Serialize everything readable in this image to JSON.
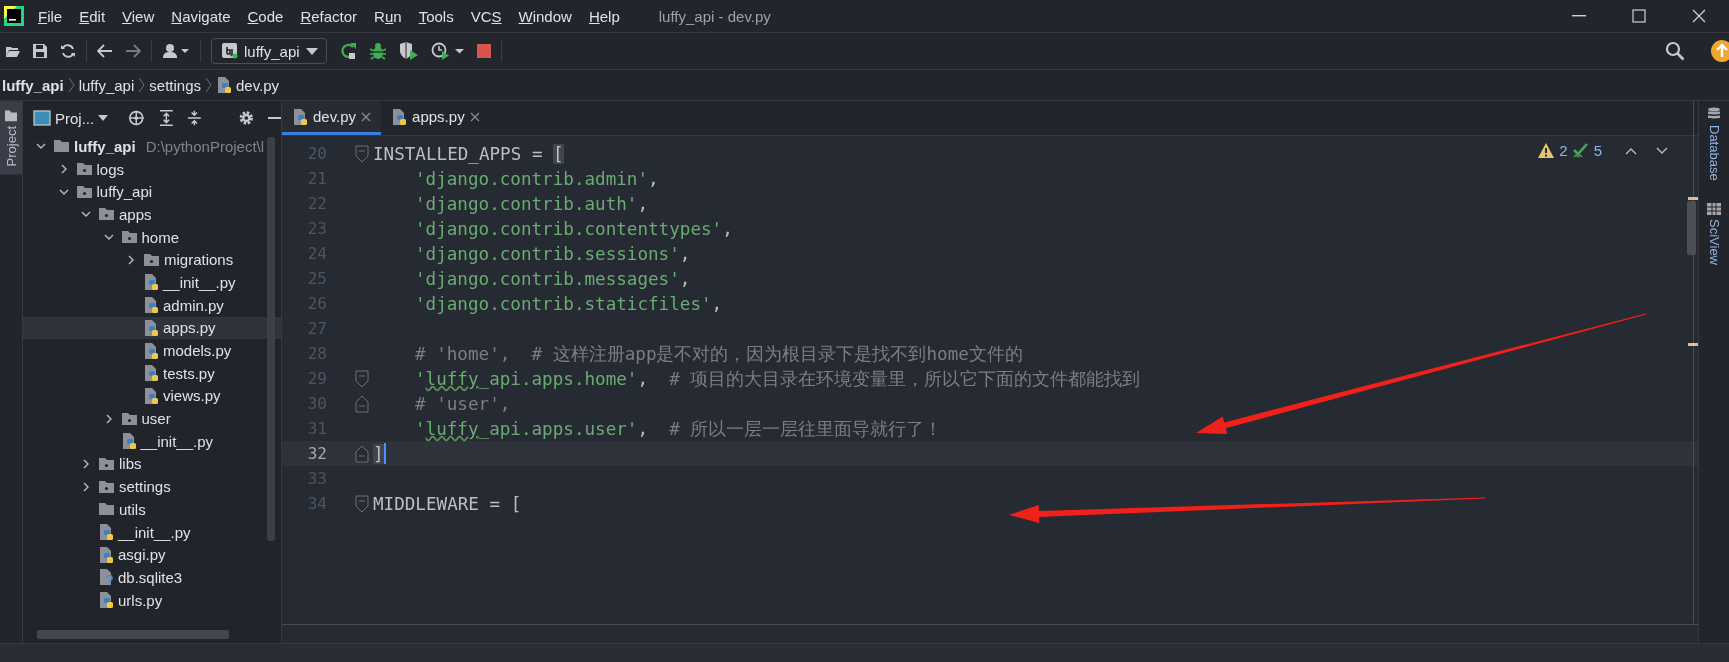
{
  "window": {
    "title": "luffy_api - dev.py"
  },
  "menu": [
    {
      "key": "F",
      "post": "ile"
    },
    {
      "key": "E",
      "post": "dit"
    },
    {
      "key": "V",
      "post": "iew"
    },
    {
      "key": "N",
      "post": "avigate"
    },
    {
      "key": "C",
      "post": "ode"
    },
    {
      "key": "R",
      "post": "efactor"
    },
    {
      "pre": "R",
      "key": "u",
      "post": "n"
    },
    {
      "key": "T",
      "post": "ools"
    },
    {
      "pre": "VC",
      "key": "S"
    },
    {
      "key": "W",
      "post": "indow"
    },
    {
      "key": "H",
      "post": "elp"
    }
  ],
  "toolbar": {
    "run_configuration": "luffy_api"
  },
  "breadcrumb": [
    "luffy_api",
    "luffy_api",
    "settings",
    "dev.py"
  ],
  "left_strip": {
    "tab": "Project",
    "selected": true
  },
  "project": {
    "title": "Proj...",
    "tree": [
      {
        "label": "luffy_api",
        "kind": "project",
        "path": "D:\\pythonProject\\l",
        "expanded": true,
        "selected": false,
        "children": [
          {
            "label": "logs",
            "kind": "package",
            "expanded": false,
            "selected": false
          },
          {
            "label": "luffy_api",
            "kind": "package",
            "expanded": true,
            "selected": false,
            "children": [
              {
                "label": "apps",
                "kind": "package",
                "expanded": true,
                "selected": false,
                "children": [
                  {
                    "label": "home",
                    "kind": "package",
                    "expanded": true,
                    "selected": false,
                    "children": [
                      {
                        "label": "migrations",
                        "kind": "package",
                        "expanded": false,
                        "selected": false
                      },
                      {
                        "label": "__init__.py",
                        "kind": "python",
                        "selected": false
                      },
                      {
                        "label": "admin.py",
                        "kind": "python",
                        "selected": false
                      },
                      {
                        "label": "apps.py",
                        "kind": "python",
                        "selected": true
                      },
                      {
                        "label": "models.py",
                        "kind": "python",
                        "selected": false
                      },
                      {
                        "label": "tests.py",
                        "kind": "python",
                        "selected": false
                      },
                      {
                        "label": "views.py",
                        "kind": "python",
                        "selected": false
                      }
                    ]
                  },
                  {
                    "label": "user",
                    "kind": "package",
                    "expanded": false,
                    "selected": false
                  },
                  {
                    "label": "__init__.py",
                    "kind": "python",
                    "selected": false
                  }
                ]
              },
              {
                "label": "libs",
                "kind": "package",
                "expanded": false,
                "selected": false
              },
              {
                "label": "settings",
                "kind": "package",
                "expanded": false,
                "selected": false
              },
              {
                "label": "utils",
                "kind": "folder",
                "selected": false
              },
              {
                "label": "__init__.py",
                "kind": "python",
                "selected": false
              },
              {
                "label": "asgi.py",
                "kind": "python",
                "selected": false
              },
              {
                "label": "db.sqlite3",
                "kind": "unknown",
                "selected": false
              },
              {
                "label": "urls.py",
                "kind": "python",
                "selected": false
              }
            ]
          }
        ]
      }
    ]
  },
  "tabs": [
    {
      "label": "dev.py",
      "selected": true
    },
    {
      "label": "apps.py",
      "selected": false
    }
  ],
  "inspections": {
    "warnings": "2",
    "typos": "5"
  },
  "editor": {
    "lines": [
      {
        "number": "20",
        "fold_start": true,
        "current": false,
        "indented": false,
        "tokens": [
          {
            "kind": "plain",
            "text": "INSTALLED_APPS = "
          },
          {
            "kind": "bracket-match",
            "text": "["
          }
        ]
      },
      {
        "number": "21",
        "current": false,
        "indented": true,
        "tokens": [
          {
            "kind": "string",
            "text": "'django.contrib.admin'"
          },
          {
            "kind": "plain",
            "text": ","
          }
        ]
      },
      {
        "number": "22",
        "current": false,
        "indented": true,
        "tokens": [
          {
            "kind": "string",
            "text": "'django.contrib.auth'"
          },
          {
            "kind": "plain",
            "text": ","
          }
        ]
      },
      {
        "number": "23",
        "current": false,
        "indented": true,
        "tokens": [
          {
            "kind": "string",
            "text": "'django.contrib.contenttypes'"
          },
          {
            "kind": "plain",
            "text": ","
          }
        ]
      },
      {
        "number": "24",
        "current": false,
        "indented": true,
        "tokens": [
          {
            "kind": "string",
            "text": "'django.contrib.sessions'"
          },
          {
            "kind": "plain",
            "text": ","
          }
        ]
      },
      {
        "number": "25",
        "current": false,
        "indented": true,
        "tokens": [
          {
            "kind": "string",
            "text": "'django.contrib.messages'"
          },
          {
            "kind": "plain",
            "text": ","
          }
        ]
      },
      {
        "number": "26",
        "current": false,
        "indented": true,
        "tokens": [
          {
            "kind": "string",
            "text": "'django.contrib.staticfiles'"
          },
          {
            "kind": "plain",
            "text": ","
          }
        ]
      },
      {
        "number": "27",
        "current": false
      },
      {
        "number": "28",
        "current": false,
        "indented": true,
        "tokens": [
          {
            "kind": "comment",
            "text": "# 'home',  # 这样注册app是不对的，因为根目录下是找不到home文件的"
          }
        ]
      },
      {
        "number": "29",
        "fold_start": true,
        "current": false,
        "indented": true,
        "tokens": [
          {
            "kind": "string",
            "text": "'"
          },
          {
            "kind": "string-typo",
            "text": "luffy"
          },
          {
            "kind": "string",
            "text": "_api.apps.home'"
          },
          {
            "kind": "plain",
            "text": ",  "
          },
          {
            "kind": "comment",
            "text": "# 项目的大目录在环境变量里，所以它下面的文件都能找到"
          }
        ]
      },
      {
        "number": "30",
        "fold_end": true,
        "current": false,
        "indented": true,
        "tokens": [
          {
            "kind": "comment",
            "text": "# 'user',"
          }
        ]
      },
      {
        "number": "31",
        "current": false,
        "indented": true,
        "tokens": [
          {
            "kind": "string",
            "text": "'"
          },
          {
            "kind": "string-typo",
            "text": "luffy"
          },
          {
            "kind": "string",
            "text": "_api.apps.user'"
          },
          {
            "kind": "plain",
            "text": ",  "
          },
          {
            "kind": "comment",
            "text": "# 所以一层一层往里面导就行了！"
          }
        ]
      },
      {
        "number": "32",
        "fold_end": true,
        "current": true,
        "indented": false,
        "tokens": [
          {
            "kind": "bracket-match",
            "text": "]"
          }
        ]
      },
      {
        "number": "33",
        "current": false
      },
      {
        "number": "34",
        "fold_start": true,
        "current": false,
        "indented": false,
        "tokens": [
          {
            "kind": "plain",
            "text": "MIDDLEWARE = ["
          }
        ]
      }
    ]
  },
  "right_strip": [
    {
      "label": "Database",
      "kind": "database"
    },
    {
      "label": "SciView",
      "kind": "sciview"
    }
  ]
}
